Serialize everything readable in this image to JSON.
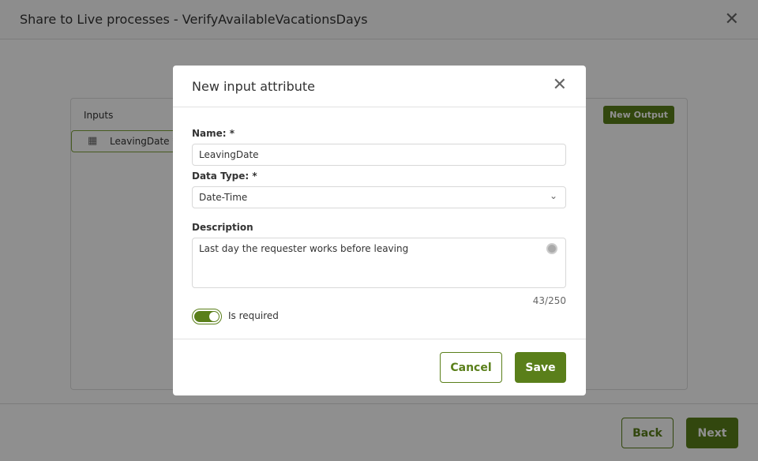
{
  "header": {
    "title": "Share to Live processes - VerifyAvailableVacationsDays",
    "close_icon": "close-icon"
  },
  "panel": {
    "inputs_label": "Inputs",
    "input_item": "LeavingDate *",
    "new_output": "New Output"
  },
  "footer": {
    "back": "Back",
    "next": "Next"
  },
  "modal": {
    "title": "New input attribute",
    "name_label": "Name: *",
    "name_value": "LeavingDate",
    "type_label": "Data Type: *",
    "type_value": "Date-Time",
    "desc_label": "Description",
    "desc_value": "Last day the requester works before leaving",
    "counter": "43/250",
    "required_label": "Is required",
    "required_on": true,
    "cancel": "Cancel",
    "save": "Save"
  },
  "colors": {
    "accent": "#5a7f1a"
  }
}
